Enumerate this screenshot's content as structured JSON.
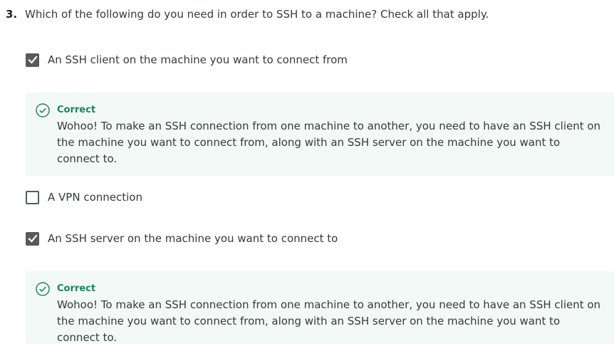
{
  "question": {
    "number": "3.",
    "text": "Which of the following do you need in order to SSH to a machine? Check all that apply."
  },
  "options": [
    {
      "label": "An SSH client on the machine you want to connect from",
      "checked": true
    },
    {
      "label": "A VPN connection",
      "checked": false
    },
    {
      "label": "An SSH server on the machine you want to connect to",
      "checked": true
    }
  ],
  "feedback": [
    {
      "status": "Correct",
      "text": "Wohoo! To make an SSH connection from one machine to another, you need to have an SSH client on the machine you want to connect from, along with an SSH server on the machine you want to connect to."
    },
    {
      "status": "Correct",
      "text": "Wohoo! To make an SSH connection from one machine to another, you need to have an SSH client on the machine you want to connect from, along with an SSH server on the machine you want to connect to."
    }
  ],
  "colors": {
    "correct": "#1f8354",
    "feedback_bg": "#f3f9f6",
    "checkbox": "#555a5e"
  }
}
